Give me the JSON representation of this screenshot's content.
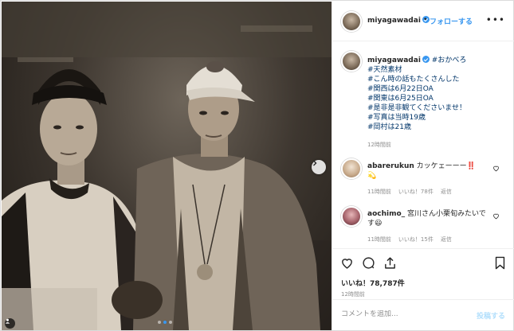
{
  "header": {
    "username": "miyagawadai",
    "separator": "•",
    "follow_label": "フォローする",
    "more_label": "•••"
  },
  "caption": {
    "username": "miyagawadai",
    "lines": [
      "#おかべろ",
      "#天然素材",
      "#こん時の話もたくさんした",
      "#関西は6月22日OA",
      "#関東は6月25日OA",
      "#是非是非観てくださいませ！",
      "#写真は当時19歳",
      "#岡村は21歳"
    ],
    "time": "12時間前"
  },
  "comments": [
    {
      "username": "abarerukun",
      "text": "カッケェーーー‼️",
      "emoji": "💫",
      "time": "11時間前",
      "likes": "いいね！78件",
      "reply": "返信"
    },
    {
      "username": "aochimo_",
      "text": "宮川さん小栗旬みたいです😃",
      "time": "11時間前",
      "likes": "いいね！15件",
      "reply": "返信"
    }
  ],
  "actions": {
    "likes_label": "いいね！78,787件",
    "time": "12時間前"
  },
  "add_comment": {
    "placeholder": "コメントを追加...",
    "post_label": "投稿する"
  },
  "carousel": {
    "slide_count": 3,
    "active_index": 1
  },
  "colors": {
    "accent": "#3897f0",
    "text": "#262626",
    "muted": "#8e8e8e",
    "hashtag": "#003569"
  }
}
